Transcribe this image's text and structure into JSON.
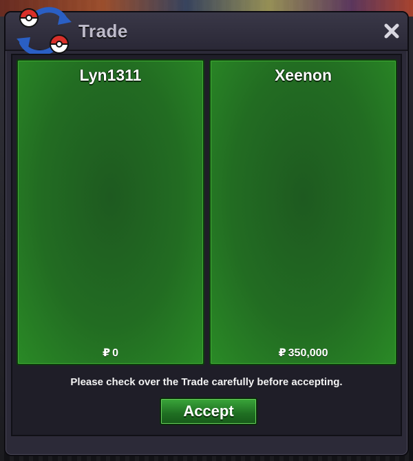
{
  "window": {
    "title": "Trade",
    "close_icon": "close-icon",
    "logo_icon": "trade-exchange-icon"
  },
  "trade": {
    "left": {
      "name": "Lyn1311",
      "currency_symbol": "₽",
      "money": "0"
    },
    "right": {
      "name": "Xeenon",
      "currency_symbol": "₽",
      "money": "350,000"
    }
  },
  "footer": {
    "message": "Please check over the Trade carefully before accepting.",
    "accept_label": "Accept"
  },
  "colors": {
    "panel_green": "#226c22",
    "button_green": "#2a8a2a",
    "window_bg": "#2c2a38",
    "logo_red": "#d9302a",
    "logo_blue": "#2a5fc4"
  }
}
